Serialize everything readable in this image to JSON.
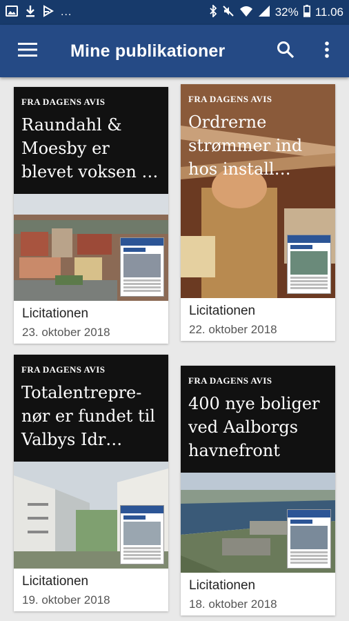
{
  "status": {
    "battery": "32%",
    "time": "11.06",
    "more": "..."
  },
  "appbar": {
    "title": "Mine publikationer"
  },
  "colors": {
    "statusbar": "#173a6b",
    "appbar": "#254a85",
    "background": "#e9e9e9"
  },
  "cards": [
    {
      "kicker": "FRA DAGENS AVIS",
      "headline": "Raundahl & Moesby er blevet voksen …",
      "source": "Licitationen",
      "date": "23. oktober 2018"
    },
    {
      "kicker": "FRA DAGENS AVIS",
      "headline": "Ordrerne strømmer ind hos install…",
      "source": "Licitationen",
      "date": "22. oktober 2018"
    },
    {
      "kicker": "FRA DAGENS AVIS",
      "headline": "Totalentrepre-nør er fundet til Valbys Idr…",
      "source": "Licitationen",
      "date": "19. oktober 2018"
    },
    {
      "kicker": "FRA DAGENS AVIS",
      "headline": "400 nye boliger ved Aalborgs havnefront",
      "source": "Licitationen",
      "date": "18. oktober 2018"
    }
  ]
}
